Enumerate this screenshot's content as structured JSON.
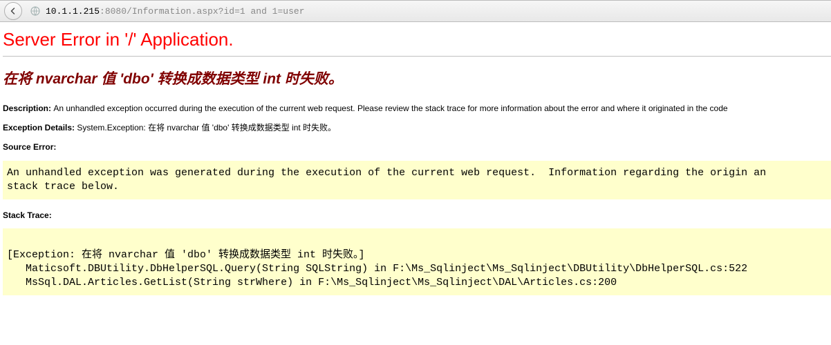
{
  "browser": {
    "url_host": "10.1.1.215",
    "url_port_colon": ":",
    "url_port": "8080",
    "url_path": "/Information.aspx?id=1 and 1=user"
  },
  "page": {
    "title": "Server Error in '/' Application.",
    "heading_pre": "在将 ",
    "heading_b1": "nvarchar",
    "heading_mid1": " 值 ",
    "heading_b2": "'dbo'",
    "heading_mid2": " 转换成数据类型 ",
    "heading_b3": "int",
    "heading_post": " 时失败。",
    "description_label": "Description: ",
    "description_text": "An unhandled exception occurred during the execution of the current web request. Please review the stack trace for more information about the error and where it originated in the code",
    "exception_label": "Exception Details: ",
    "exception_text": "System.Exception: 在将 nvarchar 值 'dbo' 转换成数据类型 int 时失败。",
    "source_error_label": "Source Error:",
    "source_error_block": "An unhandled exception was generated during the execution of the current web request.  Information regarding the origin an\nstack trace below.",
    "stack_trace_label": "Stack Trace:",
    "stack_trace_block": "\n[Exception: 在将 nvarchar 值 'dbo' 转换成数据类型 int 时失败。]\n   Maticsoft.DBUtility.DbHelperSQL.Query(String SQLString) in F:\\Ms_Sqlinject\\Ms_Sqlinject\\DBUtility\\DbHelperSQL.cs:522\n   MsSql.DAL.Articles.GetList(String strWhere) in F:\\Ms_Sqlinject\\Ms_Sqlinject\\DAL\\Articles.cs:200"
  }
}
